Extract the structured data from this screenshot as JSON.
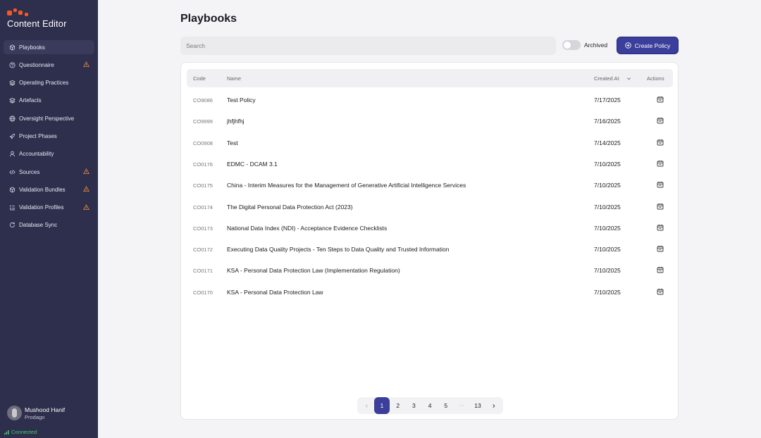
{
  "app": {
    "title": "Content Editor"
  },
  "sidebar": {
    "items": [
      {
        "label": "Playbooks",
        "icon": "package-icon",
        "active": true,
        "warning": false
      },
      {
        "label": "Questionnaire",
        "icon": "help-circle-icon",
        "active": false,
        "warning": true
      },
      {
        "label": "Operating Practices",
        "icon": "layers-icon",
        "active": false,
        "warning": false
      },
      {
        "label": "Artefacts",
        "icon": "layers-icon",
        "active": false,
        "warning": false
      },
      {
        "label": "Oversight Perspective",
        "icon": "globe-icon",
        "active": false,
        "warning": false
      },
      {
        "label": "Project Phases",
        "icon": "rocket-icon",
        "active": false,
        "warning": false
      },
      {
        "label": "Accountability",
        "icon": "user-icon",
        "active": false,
        "warning": false
      },
      {
        "label": "Sources",
        "icon": "code-icon",
        "active": false,
        "warning": true
      },
      {
        "label": "Validation Bundles",
        "icon": "package-icon",
        "active": false,
        "warning": true
      },
      {
        "label": "Validation Profiles",
        "icon": "list-checks-icon",
        "active": false,
        "warning": true
      },
      {
        "label": "Database Sync",
        "icon": "refresh-icon",
        "active": false,
        "warning": false
      }
    ]
  },
  "user": {
    "name": "Mushood Hanif",
    "org": "Prodago"
  },
  "status": {
    "text": "Connected",
    "color": "#3fcf6f"
  },
  "main": {
    "title": "Playbooks",
    "search": {
      "placeholder": "Search",
      "value": ""
    },
    "archived": {
      "label": "Archived",
      "on": false
    },
    "create_button": "Create Policy"
  },
  "table": {
    "headers": {
      "code": "Code",
      "name": "Name",
      "created": "Created At",
      "actions": "Actions"
    },
    "rows": [
      {
        "code": "CO9086",
        "name": "Test Policy",
        "date": "7/17/2025"
      },
      {
        "code": "CO9999",
        "name": "jhfjhfhj",
        "date": "7/16/2025"
      },
      {
        "code": "CO0908",
        "name": "Test",
        "date": "7/14/2025"
      },
      {
        "code": "CO0176",
        "name": "EDMC - DCAM 3.1",
        "date": "7/10/2025"
      },
      {
        "code": "CO0175",
        "name": "China - Interim Measures for the Management of Generative Artificial Intelligence Services",
        "date": "7/10/2025"
      },
      {
        "code": "CO0174",
        "name": "The Digital Personal Data Protection Act (2023)",
        "date": "7/10/2025"
      },
      {
        "code": "CO0173",
        "name": "National Data Index (NDI) - Acceptance Evidence Checklists",
        "date": "7/10/2025"
      },
      {
        "code": "CO0172",
        "name": "Executing Data Quality Projects - Ten Steps to Data Quality and Trusted Information",
        "date": "7/10/2025"
      },
      {
        "code": "CO0171",
        "name": "KSA - Personal Data Protection Law (Implementation Regulation)",
        "date": "7/10/2025"
      },
      {
        "code": "CO0170",
        "name": "KSA - Personal Data Protection Law",
        "date": "7/10/2025"
      }
    ]
  },
  "pagination": {
    "pages": [
      "1",
      "2",
      "3",
      "4",
      "5"
    ],
    "ellipsis": "···",
    "last": "13",
    "current": "1"
  },
  "colors": {
    "sidebar": "#2e2e4d",
    "accent": "#3b3e9a",
    "warning": "#e8893a",
    "brand": "#ef5a2a"
  }
}
